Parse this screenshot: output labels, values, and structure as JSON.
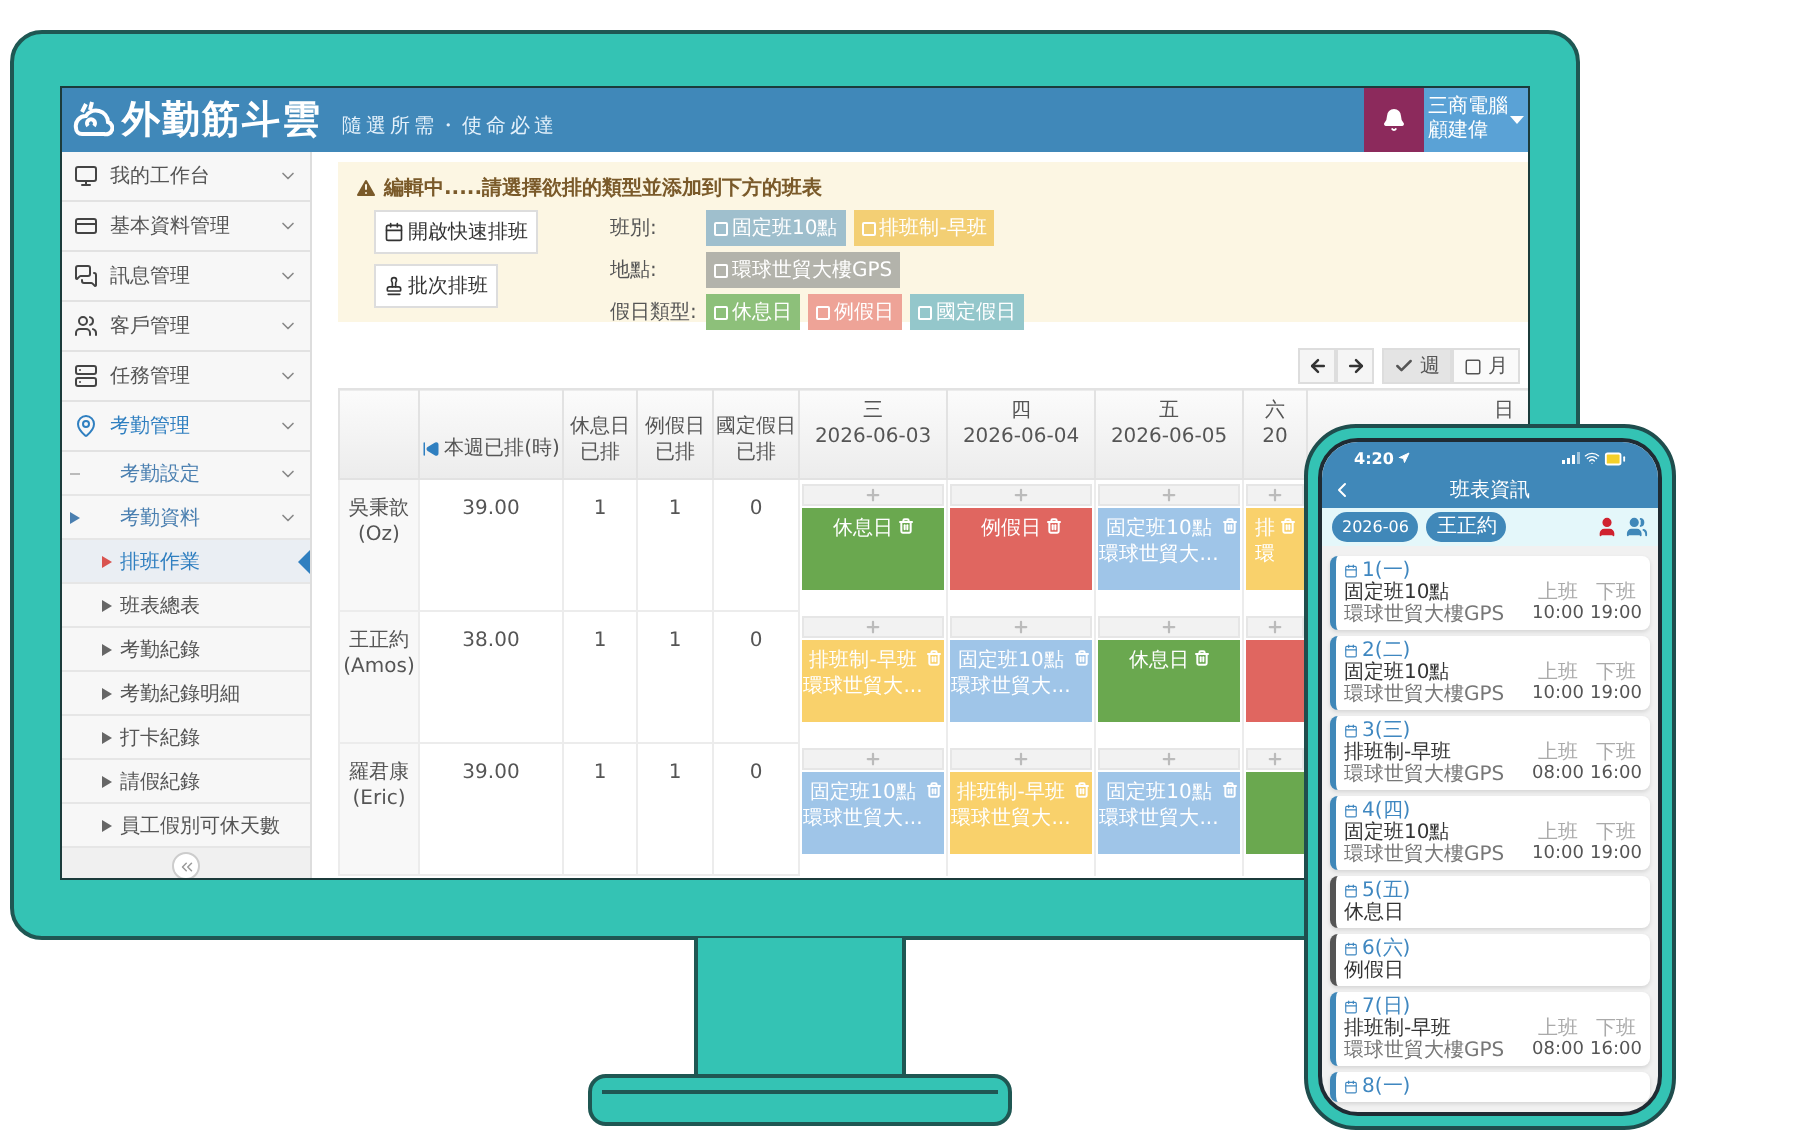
{
  "header": {
    "logo": "外勤筋斗雲",
    "slogan": "隨選所需・使命必達",
    "company": "三商電腦",
    "user": "顧建偉"
  },
  "sidebar": {
    "items": [
      {
        "label": "我的工作台",
        "active": false
      },
      {
        "label": "基本資料管理",
        "active": false
      },
      {
        "label": "訊息管理",
        "active": false
      },
      {
        "label": "客戶管理",
        "active": false
      },
      {
        "label": "任務管理",
        "active": false
      },
      {
        "label": "考勤管理",
        "active": true,
        "children": [
          {
            "label": "考勤設定",
            "expanded": false
          },
          {
            "label": "考勤資料",
            "expanded": true,
            "children": [
              {
                "label": "排班作業",
                "selected": true
              },
              {
                "label": "班表總表",
                "selected": false
              },
              {
                "label": "考勤紀錄",
                "selected": false
              },
              {
                "label": "考勤紀錄明細",
                "selected": false
              },
              {
                "label": "打卡紀錄",
                "selected": false
              },
              {
                "label": "請假紀錄",
                "selected": false
              },
              {
                "label": "員工假別可休天數",
                "selected": false
              }
            ]
          }
        ]
      }
    ]
  },
  "notice": {
    "title": "編輯中.....請選擇欲排的類型並添加到下方的班表",
    "buttons": [
      "開啟快速排班",
      "批次排班"
    ],
    "filters": [
      {
        "label": "班別:",
        "chips": [
          {
            "label": "固定班10點",
            "kind": "fixed"
          },
          {
            "label": "排班制-早班",
            "kind": "early"
          }
        ]
      },
      {
        "label": "地點:",
        "chips": [
          {
            "label": "環球世貿大樓GPS",
            "kind": "place"
          }
        ]
      },
      {
        "label": "假日類型:",
        "chips": [
          {
            "label": "休息日",
            "kind": "rest"
          },
          {
            "label": "例假日",
            "kind": "off"
          },
          {
            "label": "國定假日",
            "kind": "holiday"
          }
        ]
      }
    ]
  },
  "toolbar": {
    "views": [
      {
        "label": "週",
        "selected": true
      },
      {
        "label": "月",
        "selected": false
      }
    ]
  },
  "table": {
    "columns": [
      {
        "lines": [
          "本週已排(時)"
        ]
      },
      {
        "lines": [
          "休息日",
          "已排"
        ]
      },
      {
        "lines": [
          "例假日",
          "已排"
        ]
      },
      {
        "lines": [
          "國定假日",
          "已排"
        ]
      }
    ],
    "days": [
      {
        "day": "三",
        "date": "2026-06-03"
      },
      {
        "day": "四",
        "date": "2026-06-04"
      },
      {
        "day": "五",
        "date": "2026-06-05"
      },
      {
        "day": "六",
        "date": "20"
      },
      {
        "day": "日"
      }
    ],
    "rows": [
      {
        "name": "吳秉歆",
        "alias": "(Oz)",
        "values": [
          "39.00",
          "1",
          "1",
          "0"
        ],
        "shifts": [
          {
            "kind": "rest",
            "title": "休息日"
          },
          {
            "kind": "off",
            "title": "例假日"
          },
          {
            "kind": "fixed",
            "title": "固定班10點",
            "place": "環球世貿大..."
          },
          {
            "kind": "early",
            "title": "排",
            "place": "環"
          }
        ]
      },
      {
        "name": "王正約",
        "alias": "(Amos)",
        "values": [
          "38.00",
          "1",
          "1",
          "0"
        ],
        "shifts": [
          {
            "kind": "early",
            "title": "排班制-早班",
            "place": "環球世貿大..."
          },
          {
            "kind": "fixed",
            "title": "固定班10點",
            "place": "環球世貿大..."
          },
          {
            "kind": "rest",
            "title": "休息日"
          },
          {
            "kind": "off"
          }
        ]
      },
      {
        "name": "羅君康",
        "alias": "(Eric)",
        "values": [
          "39.00",
          "1",
          "1",
          "0"
        ],
        "shifts": [
          {
            "kind": "fixed",
            "title": "固定班10點",
            "place": "環球世貿大..."
          },
          {
            "kind": "early",
            "title": "排班制-早班",
            "place": "環球世貿大..."
          },
          {
            "kind": "fixed",
            "title": "固定班10點",
            "place": "環球世貿大..."
          },
          {
            "kind": "rest"
          }
        ]
      }
    ]
  },
  "phone": {
    "time": "4:20",
    "title": "班表資訊",
    "filters": [
      "2026-06",
      "王正約"
    ],
    "schedule": [
      {
        "date": "1(一)",
        "kind": "shift",
        "title": "固定班10點",
        "place": "環球世貿大樓GPS",
        "start_label": "上班",
        "start": "10:00",
        "end_label": "下班",
        "end": "19:00"
      },
      {
        "date": "2(二)",
        "kind": "shift",
        "title": "固定班10點",
        "place": "環球世貿大樓GPS",
        "start_label": "上班",
        "start": "10:00",
        "end_label": "下班",
        "end": "19:00"
      },
      {
        "date": "3(三)",
        "kind": "shift",
        "title": "排班制-早班",
        "place": "環球世貿大樓GPS",
        "start_label": "上班",
        "start": "08:00",
        "end_label": "下班",
        "end": "16:00"
      },
      {
        "date": "4(四)",
        "kind": "shift",
        "title": "固定班10點",
        "place": "環球世貿大樓GPS",
        "start_label": "上班",
        "start": "10:00",
        "end_label": "下班",
        "end": "19:00"
      },
      {
        "date": "5(五)",
        "kind": "dayoff",
        "title": "休息日"
      },
      {
        "date": "6(六)",
        "kind": "dayoff",
        "title": "例假日"
      },
      {
        "date": "7(日)",
        "kind": "shift",
        "title": "排班制-早班",
        "place": "環球世貿大樓GPS",
        "start_label": "上班",
        "start": "08:00",
        "end_label": "下班",
        "end": "16:00"
      },
      {
        "date": "8(一)",
        "kind": "shift"
      }
    ]
  }
}
